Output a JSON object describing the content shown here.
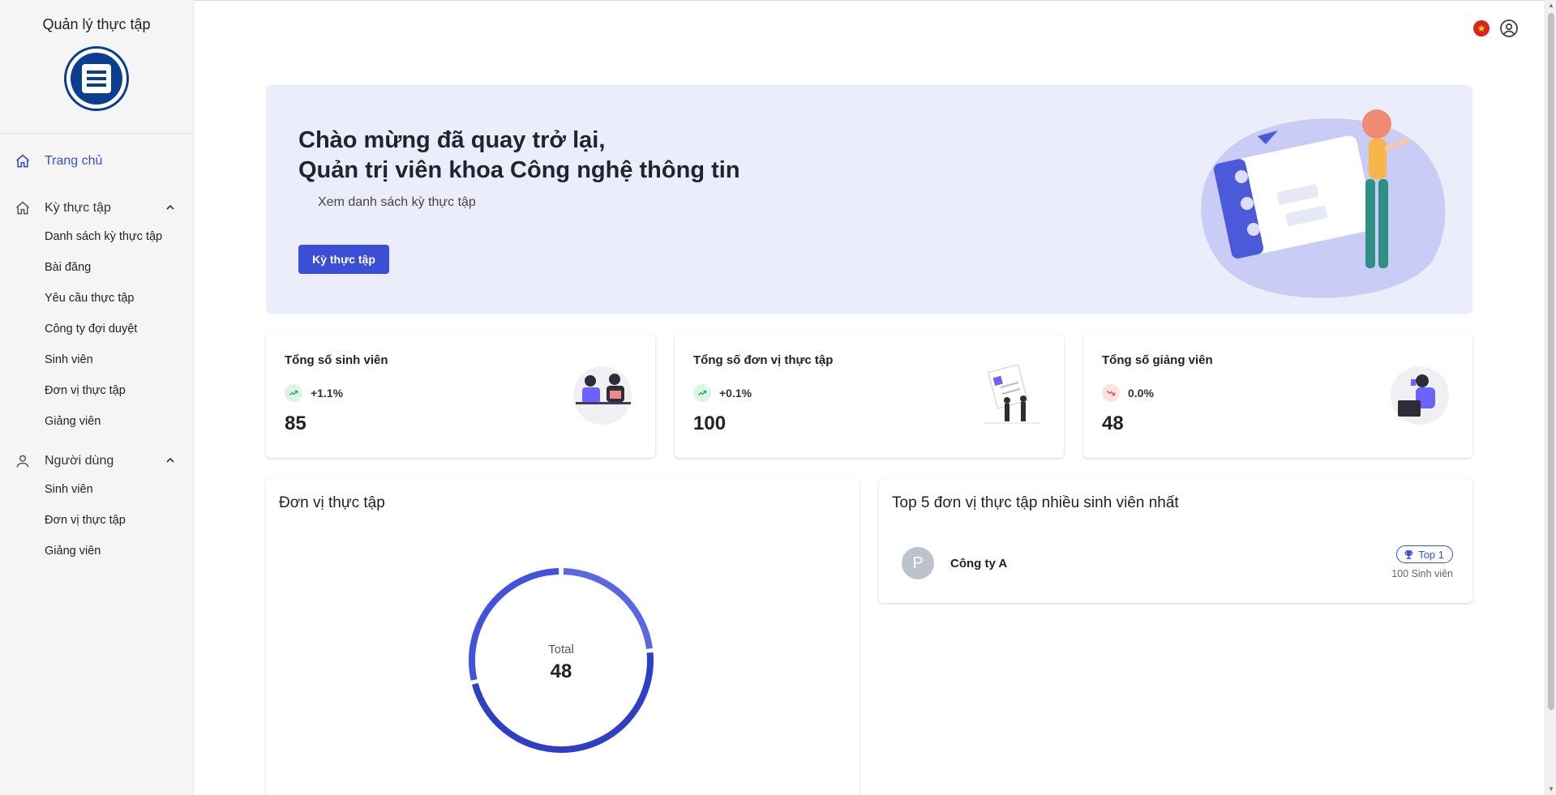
{
  "sidebar": {
    "title": "Quản lý thực tập",
    "home": "Trang chủ",
    "section1": {
      "label": "Kỳ thực tập",
      "items": [
        "Danh sách kỳ thực tập",
        "Bài đăng",
        "Yêu cầu thực tập",
        "Công ty đợi duyệt",
        "Sinh viên",
        "Đơn vị thực tập",
        "Giảng viên"
      ]
    },
    "section2": {
      "label": "Người dùng",
      "items": [
        "Sinh viên",
        "Đơn vị thực tập",
        "Giảng viên"
      ]
    }
  },
  "hero": {
    "line1": "Chào mừng đã quay trở lại,",
    "line2": "Quản trị viên khoa Công nghệ thông tin",
    "subtitle": "Xem danh sách kỳ thực tập",
    "button": "Kỳ thực tập"
  },
  "stats": [
    {
      "title": "Tổng số sinh viên",
      "trend": "+1.1%",
      "direction": "up",
      "value": "85"
    },
    {
      "title": "Tổng số đơn vị thực tập",
      "trend": "+0.1%",
      "direction": "up",
      "value": "100"
    },
    {
      "title": "Tổng số giảng viên",
      "trend": "0.0%",
      "direction": "down",
      "value": "48"
    }
  ],
  "chart_panel": {
    "title": "Đơn vị thực tập",
    "total_label": "Total",
    "total_value": "48"
  },
  "top_panel": {
    "title": "Top 5 đơn vị thực tập nhiều sinh viên nhất",
    "rows": [
      {
        "avatar": "P",
        "name": "Công ty A",
        "badge": "Top 1",
        "count": "100 Sinh viên"
      }
    ]
  },
  "colors": {
    "accent": "#3b4fd6",
    "hero_bg": "#ecedfb",
    "sidebar_bg": "#f5f5f5"
  }
}
